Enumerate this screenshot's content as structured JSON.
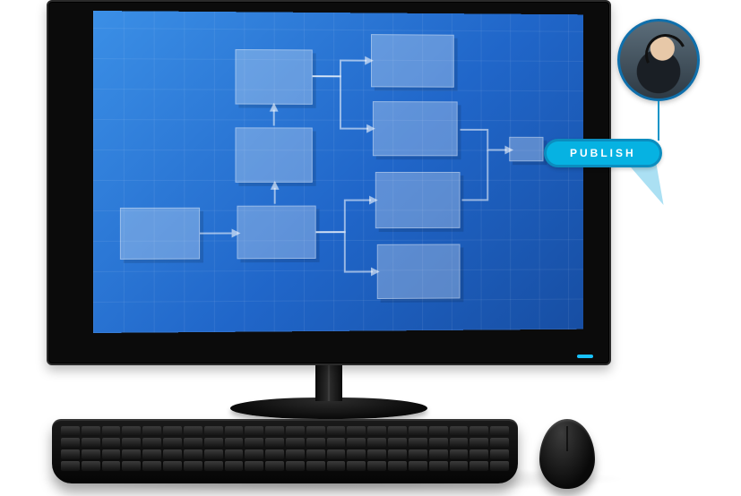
{
  "publish": {
    "label": "PUBLISH"
  },
  "avatar": {
    "role": "support-agent"
  },
  "icons": {
    "arrow_right": "arrow-right-icon",
    "arrow_up": "arrow-up-icon"
  },
  "colors": {
    "screen_gradient_start": "#3b8fe6",
    "screen_gradient_end": "#174ea3",
    "publish_bg": "#06b2e2",
    "publish_border": "#0b8dbf",
    "avatar_ring": "#0f6fab"
  }
}
